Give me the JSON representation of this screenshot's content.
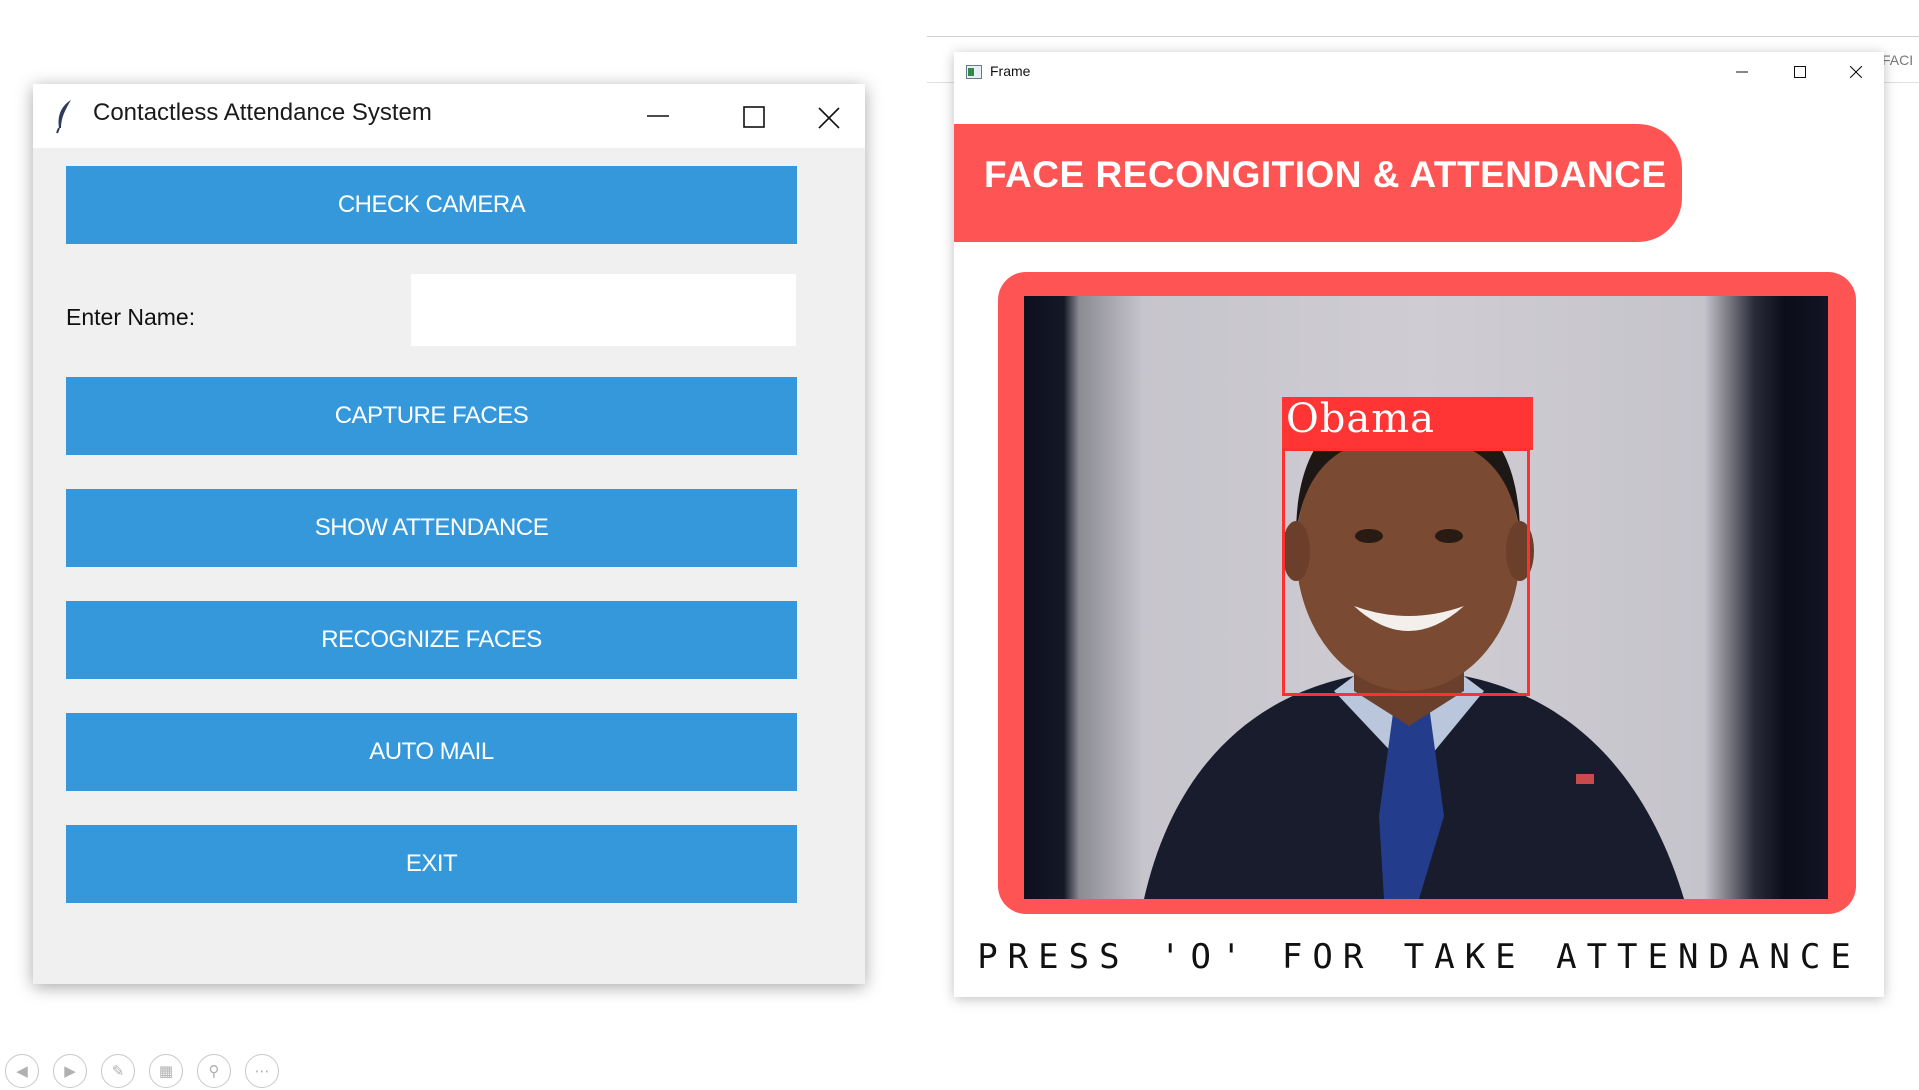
{
  "left_window": {
    "title": "Contactless Attendance System",
    "icon": "feather-icon",
    "buttons": {
      "check_camera": "CHECK CAMERA",
      "capture_faces": "CAPTURE FACES",
      "show_attendance": "SHOW ATTENDANCE",
      "recognize_faces": "RECOGNIZE FACES",
      "auto_mail": "AUTO MAIL",
      "exit": "EXIT"
    },
    "name_field": {
      "label": "Enter Name:",
      "value": ""
    },
    "button_color": "#3498db"
  },
  "background_app": {
    "partial_text": "FACI"
  },
  "frame_window": {
    "title": "Frame",
    "banner_text": "FACE RECONGITION & ATTENDANCE",
    "accent_color": "#ff5454",
    "detected_name": "Obama",
    "instruction": "PRESS 'O' FOR TAKE ATTENDANCE"
  },
  "toolbar": {
    "icons": [
      "previous-icon",
      "next-icon",
      "pen-icon",
      "slides-icon",
      "zoom-icon",
      "more-icon"
    ]
  }
}
